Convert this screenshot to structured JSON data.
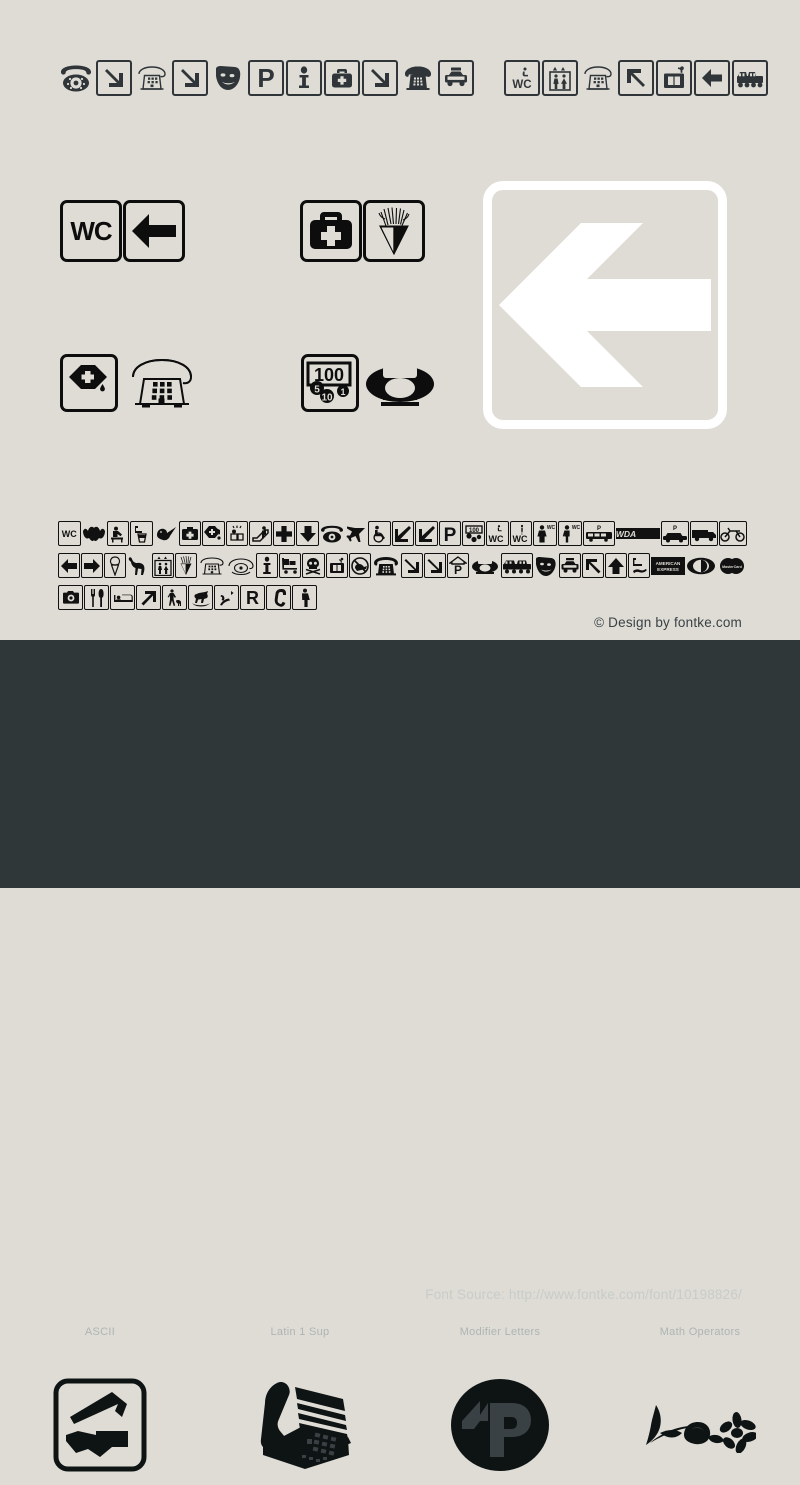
{
  "page": {
    "background_light": "#dedcd5",
    "background_dark": "#2f3739",
    "ink_dark": "#2f3538",
    "ink_black": "#0d0d0d",
    "hero_stroke": "#ffffff"
  },
  "top_strip": {
    "group_a": [
      {
        "icon": "rotary-telephone-icon",
        "boxed": false
      },
      {
        "icon": "arrow-down-right-icon",
        "boxed": true
      },
      {
        "icon": "desk-telephone-icon",
        "boxed": false
      },
      {
        "icon": "arrow-down-right-icon",
        "boxed": true
      },
      {
        "icon": "theatre-masks-icon",
        "boxed": false
      },
      {
        "icon": "parking-p-icon",
        "boxed": true
      },
      {
        "icon": "information-i-icon",
        "boxed": true
      },
      {
        "icon": "first-aid-kit-icon",
        "boxed": true
      },
      {
        "icon": "arrow-down-right-icon",
        "boxed": true
      },
      {
        "icon": "public-telephone-icon",
        "boxed": false
      },
      {
        "icon": "taxi-car-icon",
        "boxed": true
      }
    ],
    "group_b": [
      {
        "icon": "wc-accessible-icon",
        "boxed": true
      },
      {
        "icon": "elevator-icon",
        "boxed": true
      },
      {
        "icon": "desk-telephone-icon",
        "boxed": false
      },
      {
        "icon": "arrow-up-left-icon",
        "boxed": true
      },
      {
        "icon": "luggage-locker-icon",
        "boxed": true
      },
      {
        "icon": "arrow-left-icon",
        "boxed": true
      },
      {
        "icon": "train-icon",
        "boxed": true
      }
    ]
  },
  "samples": {
    "row1_left": [
      {
        "icon": "wc-text-icon",
        "label": "WC",
        "boxed": true
      },
      {
        "icon": "arrow-left-icon",
        "boxed": true
      }
    ],
    "row1_right": [
      {
        "icon": "first-aid-kit-icon",
        "boxed": true
      },
      {
        "icon": "fireworks-icon",
        "boxed": true
      }
    ],
    "row2_left": [
      {
        "icon": "fuel-can-icon",
        "boxed": true
      },
      {
        "icon": "desk-telephone-icon",
        "boxed": false
      }
    ],
    "row2_right": [
      {
        "icon": "money-change-100-icon",
        "boxed": true,
        "values": [
          "100",
          "5",
          "10",
          "1"
        ]
      },
      {
        "icon": "rotary-telephone-silhouette-icon",
        "boxed": false
      }
    ]
  },
  "hero": {
    "icon": "arrow-left-icon",
    "frame_color": "#ffffff"
  },
  "dense_rows": [
    [
      {
        "icon": "wc-text-icon",
        "label": "WC",
        "boxed": true
      },
      {
        "icon": "bat-icon",
        "boxed": false
      },
      {
        "icon": "baby-changing-icon",
        "boxed": true
      },
      {
        "icon": "drinking-water-icon",
        "boxed": true
      },
      {
        "icon": "bird-icon",
        "boxed": false
      },
      {
        "icon": "first-aid-kit-icon",
        "boxed": true
      },
      {
        "icon": "fuel-can-icon",
        "boxed": true
      },
      {
        "icon": "nursery-icon",
        "boxed": true
      },
      {
        "icon": "escalator-icon",
        "boxed": true
      },
      {
        "icon": "hospital-cross-icon",
        "boxed": true
      },
      {
        "icon": "arrow-down-icon",
        "boxed": true
      },
      {
        "icon": "rotary-telephone-icon",
        "boxed": false
      },
      {
        "icon": "airplane-icon",
        "boxed": false
      },
      {
        "icon": "wheelchair-icon",
        "boxed": true
      },
      {
        "icon": "arrow-down-left-icon",
        "boxed": true
      },
      {
        "icon": "arrow-down-left-icon",
        "boxed": true
      },
      {
        "icon": "parking-p-icon",
        "boxed": true
      },
      {
        "icon": "money-change-100-icon",
        "boxed": true
      },
      {
        "icon": "wc-accessible-text-icon",
        "label": "WC",
        "boxed": true
      },
      {
        "icon": "wc-men-text-icon",
        "label": "WC",
        "boxed": true
      },
      {
        "icon": "women-wc-icon",
        "boxed": true
      },
      {
        "icon": "men-wc-icon",
        "boxed": true
      },
      {
        "icon": "bus-parking-icon",
        "boxed": true
      },
      {
        "icon": "wda-logo-icon",
        "label": "WDA",
        "boxed": false
      },
      {
        "icon": "car-parking-icon",
        "boxed": true
      },
      {
        "icon": "van-icon",
        "boxed": true
      },
      {
        "icon": "motorcycle-icon",
        "boxed": true
      }
    ],
    [
      {
        "icon": "arrow-left-icon",
        "boxed": true
      },
      {
        "icon": "arrow-right-icon",
        "boxed": true
      },
      {
        "icon": "ice-cream-icon",
        "boxed": true
      },
      {
        "icon": "camel-icon",
        "boxed": false
      },
      {
        "icon": "elevator-icon",
        "boxed": true
      },
      {
        "icon": "fireworks-icon",
        "boxed": true
      },
      {
        "icon": "desk-telephone-icon",
        "boxed": false
      },
      {
        "icon": "public-telephone-sign-icon",
        "boxed": false
      },
      {
        "icon": "information-i-icon",
        "boxed": true
      },
      {
        "icon": "luggage-cart-icon",
        "boxed": true
      },
      {
        "icon": "poison-skull-icon",
        "boxed": true
      },
      {
        "icon": "luggage-locker-icon",
        "boxed": true
      },
      {
        "icon": "no-pets-icon",
        "boxed": true
      },
      {
        "icon": "public-telephone-icon",
        "boxed": false
      },
      {
        "icon": "arrow-down-right-icon",
        "boxed": true
      },
      {
        "icon": "arrow-down-right-icon",
        "boxed": true
      },
      {
        "icon": "covered-parking-icon",
        "boxed": true
      },
      {
        "icon": "rotary-telephone-silhouette-icon",
        "boxed": false
      },
      {
        "icon": "train-icon",
        "boxed": true
      },
      {
        "icon": "theatre-masks-icon",
        "boxed": false
      },
      {
        "icon": "taxi-car-icon",
        "boxed": true
      },
      {
        "icon": "arrow-up-left-icon",
        "boxed": true
      },
      {
        "icon": "arrow-up-icon",
        "boxed": true
      },
      {
        "icon": "hand-wash-icon",
        "boxed": true
      },
      {
        "icon": "american-express-logo-icon",
        "label": "AMERICAN EXPRESS",
        "boxed": false
      },
      {
        "icon": "diners-club-logo-icon",
        "boxed": false
      },
      {
        "icon": "mastercard-logo-icon",
        "label": "MasterCard",
        "boxed": false
      }
    ],
    [
      {
        "icon": "camera-icon",
        "boxed": true
      },
      {
        "icon": "restaurant-icon",
        "boxed": true
      },
      {
        "icon": "bed-icon",
        "boxed": true
      },
      {
        "icon": "arrow-up-right-icon",
        "boxed": true
      },
      {
        "icon": "dog-walking-icon",
        "boxed": true
      },
      {
        "icon": "rocking-horse-icon",
        "boxed": true
      },
      {
        "icon": "hand-dryer-icon",
        "boxed": true
      },
      {
        "icon": "letter-r-icon",
        "label": "R",
        "boxed": true
      },
      {
        "icon": "telephone-handset-icon",
        "boxed": true
      },
      {
        "icon": "women-restroom-icon",
        "boxed": true
      }
    ]
  ],
  "copyright": "© Design by fontke.com",
  "font_source": "Font Source: http://www.fontke.com/font/10198826/",
  "categories": [
    {
      "label": "ASCII",
      "icon": "hammer-hand-icon"
    },
    {
      "label": "Latin 1 Sup",
      "icon": "office-telephone-icon"
    },
    {
      "label": "Modifier Letters",
      "icon": "circled-p-icon"
    },
    {
      "label": "Math Operators",
      "icon": "floral-ornament-icon"
    }
  ]
}
